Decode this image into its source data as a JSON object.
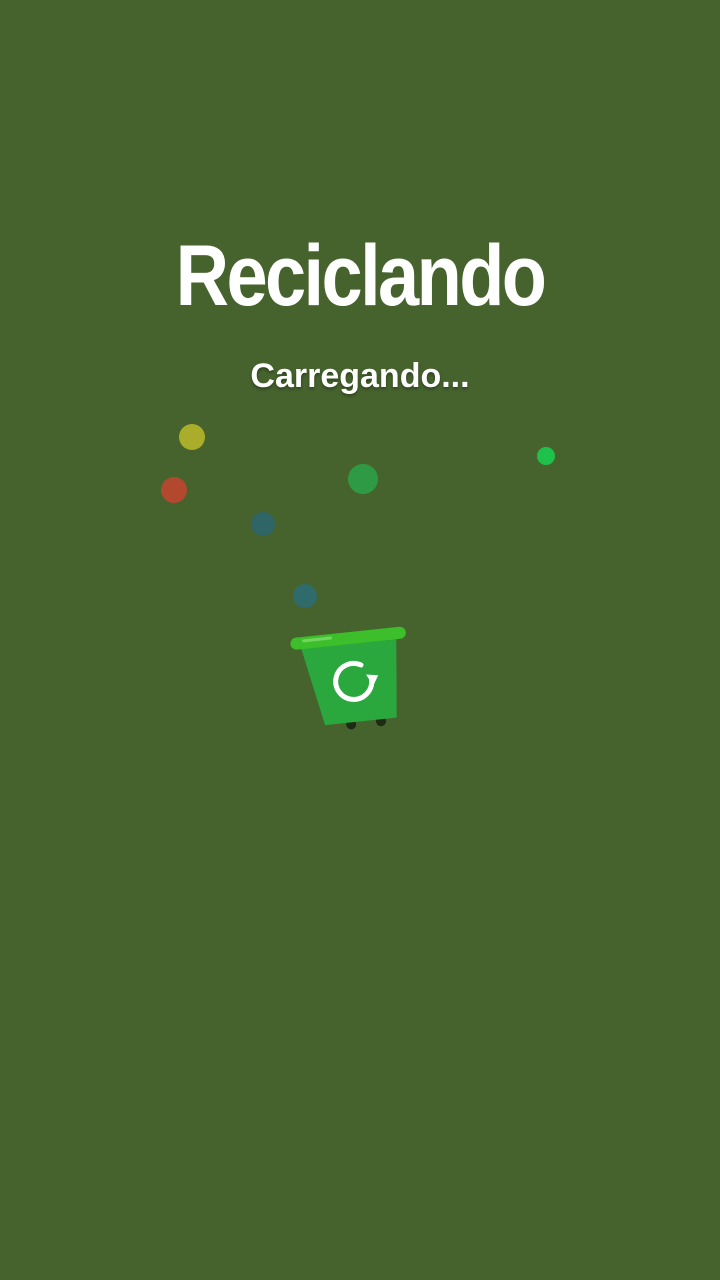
{
  "splash": {
    "title": "Reciclando",
    "loading_text": "Carregando..."
  },
  "icons": {
    "bin": "recycle-bin-icon",
    "recycle": "recycle-arrow-icon"
  },
  "colors": {
    "background": "#46632e",
    "text": "#ffffff",
    "bin_body": "#2aa83e",
    "bin_lid": "#3cbf2a",
    "particles": [
      "#a9ad2a",
      "#b2492f",
      "#2f9a45",
      "#1ec24a",
      "#2f6565",
      "#2e6b6a"
    ]
  }
}
